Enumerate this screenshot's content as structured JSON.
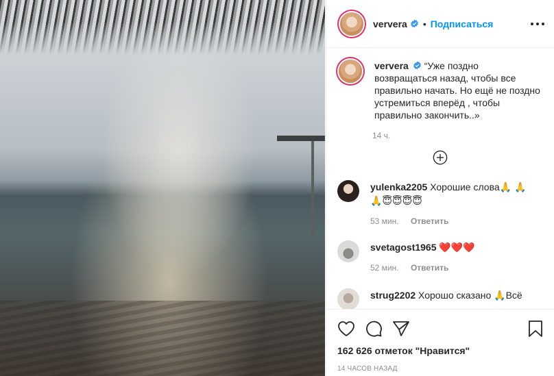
{
  "post": {
    "username": "ververa",
    "follow_label": "Подписаться",
    "separator": "•",
    "caption_author": "ververa",
    "caption_text": "“Уже поздно возвращаться назад, чтобы все правильно начать. Но ещё не поздно устремиться вперёд , чтобы правильно закончить..»",
    "caption_time": "14 ч.",
    "likes": "162 626 отметок \"Нравится\"",
    "post_time": "14 часов назад"
  },
  "comments": [
    {
      "username": "yulenka2205",
      "text": "Хорошие слова🙏 🙏 🙏😇😇😇😇",
      "time": "53 мин.",
      "reply": "Ответить"
    },
    {
      "username": "svetagost1965",
      "text": "❤️❤️❤️",
      "time": "52 мин.",
      "reply": "Ответить"
    },
    {
      "username": "strug2202",
      "text": "Хорошо сказано 🙏Всё"
    }
  ],
  "icons": {
    "verified": "verified-badge-icon",
    "more": "more-options-icon",
    "load_more": "plus-circle-icon",
    "like": "heart-icon",
    "comment": "comment-icon",
    "share": "paper-plane-icon",
    "save": "bookmark-icon"
  },
  "colors": {
    "accent": "#0095f6",
    "verified": "#3897f0",
    "text": "#262626",
    "muted": "#8e8e8e",
    "border": "#efefef"
  }
}
